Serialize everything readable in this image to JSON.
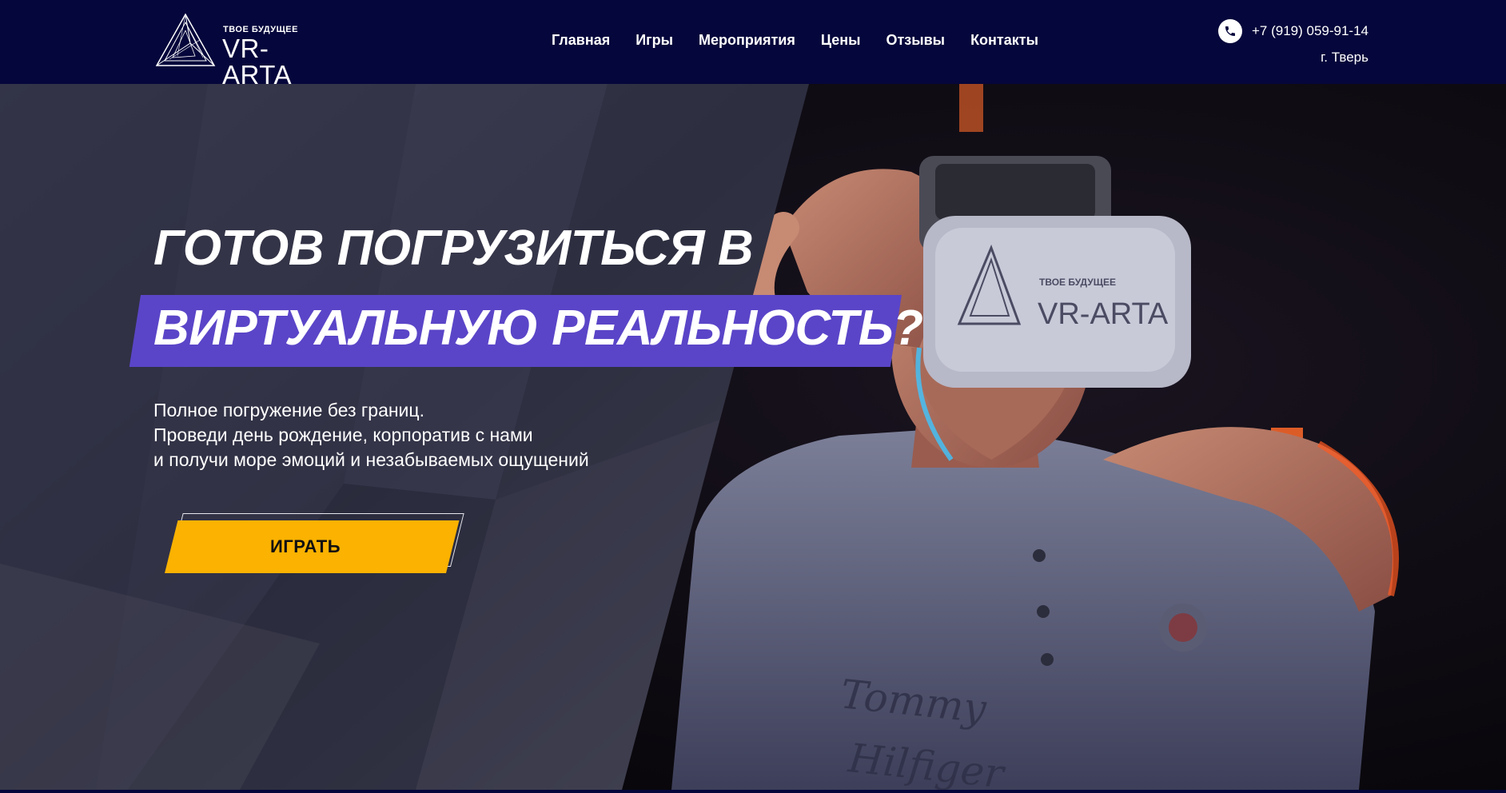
{
  "header": {
    "logo": {
      "tagline": "ТВОЕ БУДУЩЕЕ",
      "brand": "VR-ARTA"
    },
    "nav": [
      {
        "label": "Главная"
      },
      {
        "label": "Игры"
      },
      {
        "label": "Мероприятия"
      },
      {
        "label": "Цены"
      },
      {
        "label": "Отзывы"
      },
      {
        "label": "Контакты"
      }
    ],
    "phone": "+7 (919) 059-91-14",
    "city": "г. Тверь",
    "phone_icon": "phone-icon"
  },
  "hero": {
    "headline_line1": "ГОТОВ ПОГРУЗИТЬСЯ В",
    "headline_line2": "ВИРТУАЛЬНУЮ РЕАЛЬНОСТЬ?",
    "subtitle": [
      "Полное погружение без границ.",
      "Проведи день рождение, корпоратив с нами",
      "и получи море эмоций и незабываемых ощущений"
    ],
    "cta_label": "ИГРАТЬ",
    "visor_tagline": "ТВОЕ БУДУЩЕЕ",
    "visor_brand": "VR-ARTA"
  },
  "colors": {
    "header_bg": "#05063b",
    "accent_purple": "#5a45c8",
    "cta_yellow": "#fbb200"
  }
}
